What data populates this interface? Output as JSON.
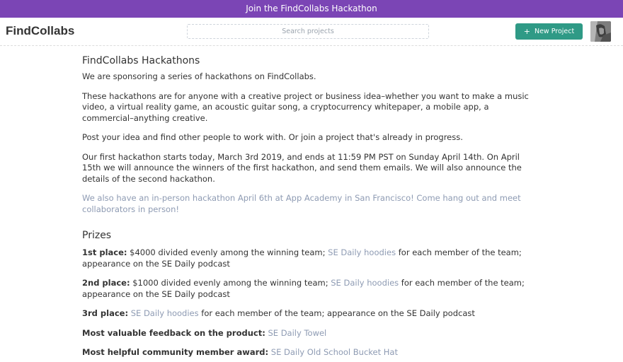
{
  "banner": {
    "text": "Join the FindCollabs Hackathon"
  },
  "header": {
    "logo": "FindCollabs",
    "search_placeholder": "Search projects",
    "new_project_icon": "+",
    "new_project_label": "New Project"
  },
  "main": {
    "title": "FindCollabs Hackathons",
    "intro": "We are sponsoring a series of hackathons on FindCollabs.",
    "para1": "These hackathons are for anyone with a creative project or business idea–whether you want to make a music video, a virtual reality game, an acoustic guitar song, a cryptocurrency whitepaper, a mobile app, a commercial–anything creative.",
    "para2": "Post your idea and find other people to work with. Or join a project that's already in progress.",
    "para3": "Our first hackathon starts today, March 3rd 2019, and ends at 11:59 PM PST on Sunday April 14th. On April 15th we will announce the winners of the first hackathon, and send them emails. We will also announce the details of the second hackathon.",
    "inperson_link": "We also have an in-person hackathon April 6th at App Academy in San Francisco! Come hang out and meet collaborators in person!"
  },
  "prizes": {
    "heading": "Prizes",
    "first": {
      "label": "1st place:",
      "before": " $4000 divided evenly among the winning team; ",
      "link": "SE Daily hoodies",
      "after": " for each member of the team; appearance on the SE Daily podcast"
    },
    "second": {
      "label": "2nd place:",
      "before": " $1000 divided evenly among the winning team; ",
      "link": "SE Daily hoodies",
      "after": " for each member of the team; appearance on the SE Daily podcast"
    },
    "third": {
      "label": "3rd place:",
      "before": " ",
      "link": "SE Daily hoodies",
      "after": " for each member of the team; appearance on the SE Daily podcast"
    },
    "feedback": {
      "label": "Most valuable feedback on the product:",
      "before": " ",
      "link": "SE Daily Towel",
      "after": ""
    },
    "community": {
      "label": "Most helpful community member award:",
      "before": " ",
      "link": "SE Daily Old School Bucket Hat",
      "after": ""
    }
  },
  "colors": {
    "banner": "#7b45b5",
    "button": "#2f9a86",
    "link": "#8e9bb3"
  }
}
